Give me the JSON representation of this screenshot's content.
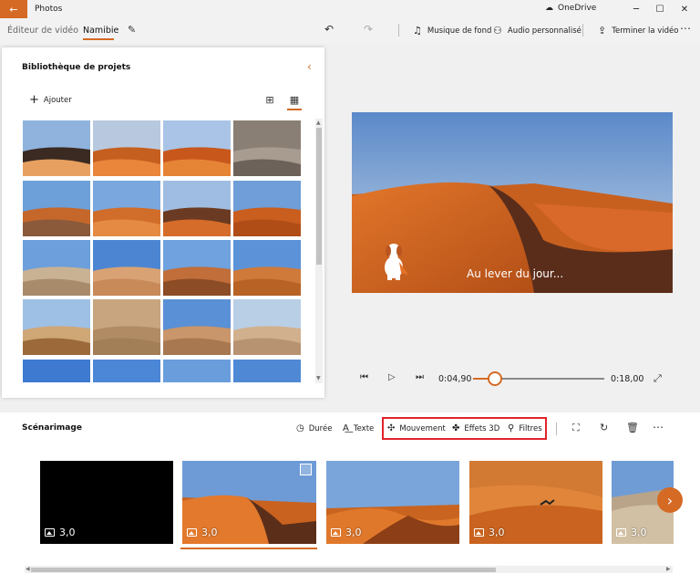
{
  "app": {
    "title": "Photos",
    "onedrive_label": "OneDrive"
  },
  "breadcrumb": {
    "parent": "Éditeur de vidéo",
    "current": "Namibie"
  },
  "toolbar": {
    "music_label": "Musique de fond",
    "audio_label": "Audio personnalisé",
    "finish_label": "Terminer la vidéo"
  },
  "library": {
    "title": "Bibliothèque de projets",
    "add_label": "Ajouter",
    "thumbnails": [
      "sunrise-dunes",
      "orange-dunes",
      "red-dunes",
      "cracked-earth",
      "dunes-trees",
      "dune-ridges",
      "dunes-shadow",
      "dune-curve",
      "desert-plain",
      "single-dune",
      "dune-valley",
      "dune-crest",
      "sand-path",
      "desert-ground",
      "lone-tree",
      "flat-desert",
      "sky-dune-1",
      "sky-dune-2",
      "sky-dune-3",
      "sky-dune-4"
    ]
  },
  "preview": {
    "caption": "Au lever du jour...",
    "current_time": "0:04,90",
    "total_time": "0:18,00",
    "progress_percent": 17
  },
  "storyboard": {
    "title": "Scénarimage",
    "tools": {
      "duration": "Durée",
      "text": "Texte",
      "motion": "Mouvement",
      "effects3d": "Effets 3D",
      "filters": "Filtres"
    },
    "frames": [
      {
        "duration": "3,0",
        "kind": "black"
      },
      {
        "duration": "3,0",
        "kind": "dune-shadow",
        "selected": true
      },
      {
        "duration": "3,0",
        "kind": "dune-valley"
      },
      {
        "duration": "3,0",
        "kind": "dune-bird"
      },
      {
        "duration": "3,0",
        "kind": "dune-tree"
      }
    ]
  },
  "colors": {
    "accent": "#d46a24",
    "highlight": "#e0242a"
  }
}
